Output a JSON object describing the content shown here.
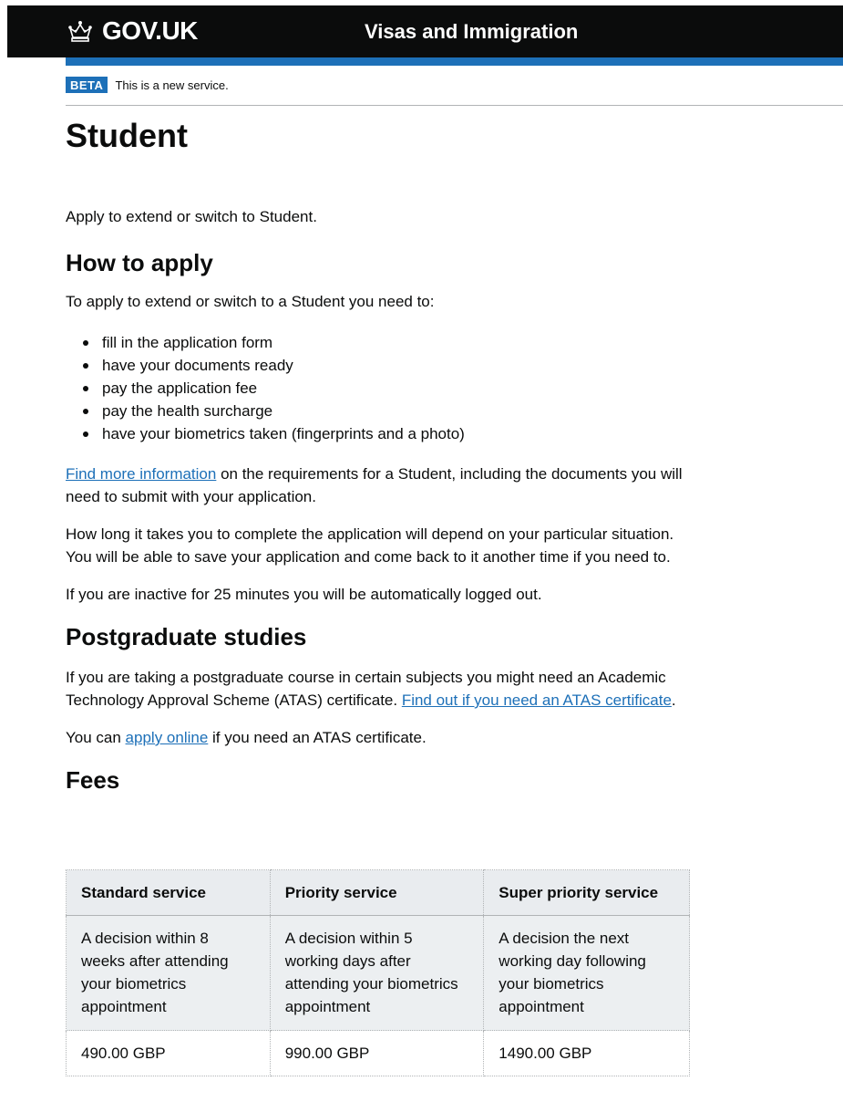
{
  "header": {
    "logo_text": "GOV.UK",
    "service_name": "Visas and Immigration"
  },
  "phase_banner": {
    "tag": "BETA",
    "text": "This is a new service."
  },
  "page_title": "Student",
  "intro": "Apply to extend or switch to Student.",
  "how_to_apply": {
    "heading": "How to apply",
    "lead": "To apply to extend or switch to a Student you need to:",
    "items": [
      "fill in the application form",
      "have your documents ready",
      "pay the application fee",
      "pay the health surcharge",
      "have your biometrics taken (fingerprints and a photo)"
    ],
    "more_info_link": "Find more information",
    "more_info_rest": " on the requirements for a Student, including the documents you will need to submit with your application.",
    "duration_text": "How long it takes you to complete the application will depend on your particular situation. You will be able to save your application and come back to it another time if you need to.",
    "inactive_text": "If you are inactive for 25 minutes you will be automatically logged out."
  },
  "postgraduate": {
    "heading": "Postgraduate studies",
    "text": "If you are taking a postgraduate course in certain subjects you might need an Academic Technology Approval Scheme (ATAS) certificate. ",
    "atas_link": "Find out if you need an ATAS certificate",
    "text_end": ".",
    "apply_prefix": "You can ",
    "apply_link": "apply online",
    "apply_suffix": " if you need an ATAS certificate."
  },
  "fees": {
    "heading": "Fees",
    "columns": [
      "Standard service",
      "Priority service",
      "Super priority service"
    ],
    "descriptions": [
      "A decision within 8 weeks after attending your biometrics appointment",
      "A decision within 5 working days after attending your biometrics appointment",
      "A decision the next working day following your biometrics appointment"
    ],
    "prices": [
      "490.00 GBP",
      "990.00 GBP",
      "1490.00 GBP"
    ]
  },
  "colors": {
    "header_bg": "#0b0c0c",
    "brand_blue": "#1d70b8",
    "link": "#1d70b8",
    "table_header_bg": "#e9ecef"
  }
}
